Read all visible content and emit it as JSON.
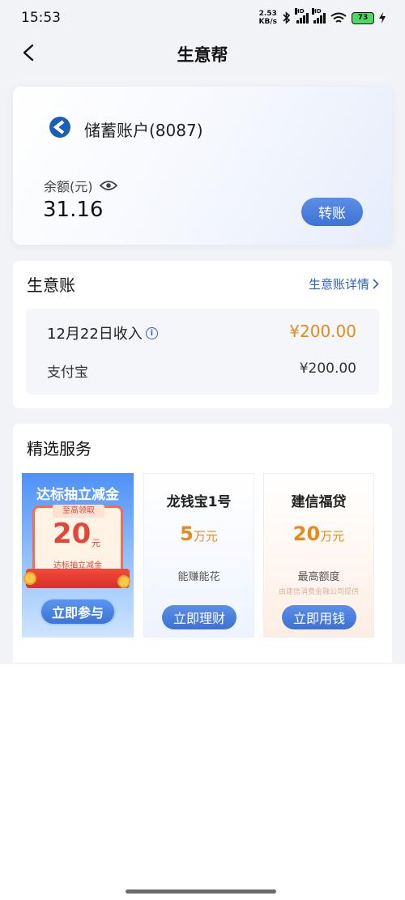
{
  "status_bar": {
    "time": "15:53",
    "net_speed_value": "2.53",
    "net_speed_unit": "KB/s",
    "signal_badge": "HD",
    "battery": "73"
  },
  "header": {
    "title": "生意帮"
  },
  "account": {
    "name": "储蓄账户(8087)",
    "balance_label": "余额(元)",
    "balance": "31.16",
    "transfer_label": "转账"
  },
  "business": {
    "title": "生意账",
    "detail_link": "生意账详情",
    "income_date": "12月22日收入",
    "income_amount": "¥200.00",
    "channel_name": "支付宝",
    "channel_amount": "¥200.00"
  },
  "services": {
    "title": "精选服务",
    "promo": {
      "headline": "达标抽立减金",
      "tag": "至高领取",
      "amount": "20",
      "unit": "元",
      "subtitle": "达标抽立减金",
      "button": "立即参与"
    },
    "products": [
      {
        "name": "龙钱宝1号",
        "amount": "5",
        "unit": "万元",
        "desc": "能赚能花",
        "provider": "",
        "button": "立即理财"
      },
      {
        "name": "建信福贷",
        "amount": "20",
        "unit": "万元",
        "desc": "最高额度",
        "provider": "由建信消费金融公司提供",
        "button": "立即用钱"
      }
    ]
  },
  "colors": {
    "accent_blue": "#3f73d3",
    "amount_orange": "#e58a1f",
    "link_blue": "#2f5fb8"
  },
  "icons": [
    "back-icon",
    "bluetooth-icon",
    "signal-icon",
    "wifi-icon",
    "battery-icon",
    "charging-icon",
    "bank-logo-icon",
    "eye-icon",
    "chevron-right-icon",
    "info-icon"
  ]
}
